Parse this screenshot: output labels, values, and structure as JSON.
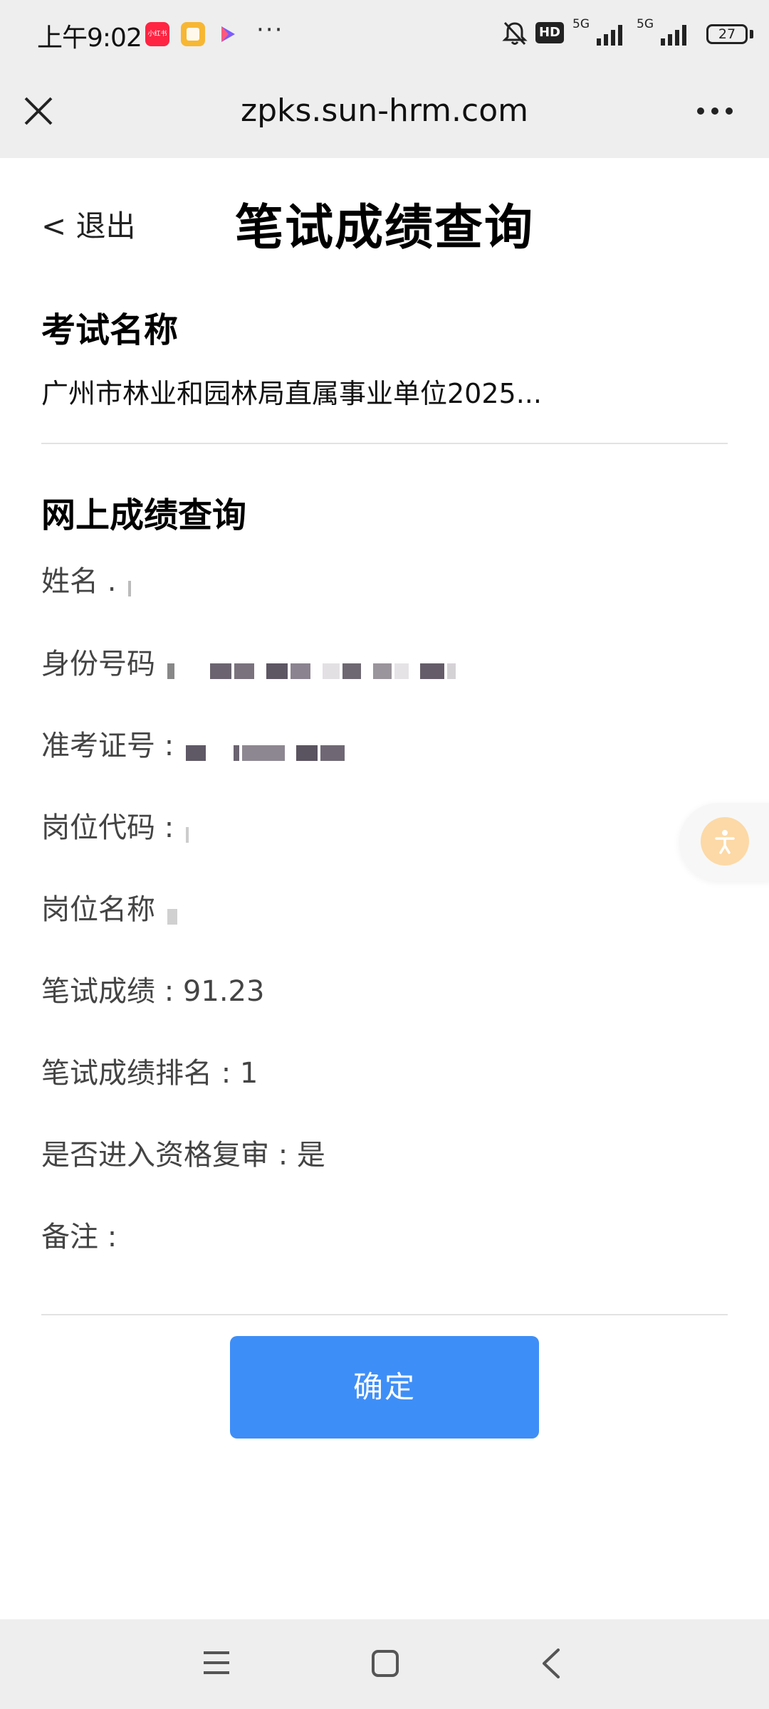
{
  "status_bar": {
    "time": "上午9:02",
    "app_icon_label": "小红书",
    "more": "···",
    "hd": "HD",
    "net1": "5G",
    "net2": "5G",
    "battery": "27"
  },
  "browser": {
    "url": "zpks.sun-hrm.com"
  },
  "page": {
    "back_label": "< 退出",
    "title": "笔试成绩查询"
  },
  "exam": {
    "section_title": "考试名称",
    "name": "广州市林业和园林局直属事业单位2025..."
  },
  "result": {
    "section_title": "网上成绩查询",
    "fields": [
      {
        "label": "姓名",
        "value": "."
      },
      {
        "label": "身份号码",
        "value": ""
      },
      {
        "label": "准考证号 :",
        "value": ""
      },
      {
        "label": "岗位代码 :",
        "value": ""
      },
      {
        "label": "岗位名称",
        "value": ""
      },
      {
        "label": "笔试成绩 :",
        "value": "91.23"
      },
      {
        "label": "笔试成绩排名 :",
        "value": "1"
      },
      {
        "label": "是否进入资格复审 :",
        "value": "是"
      },
      {
        "label": "备注 :",
        "value": ""
      }
    ]
  },
  "actions": {
    "confirm_label": "确定"
  },
  "colors": {
    "primary": "#3e8ef7",
    "accessibility_button": "#fcd9a6",
    "bar_bg": "#eeeeee"
  }
}
